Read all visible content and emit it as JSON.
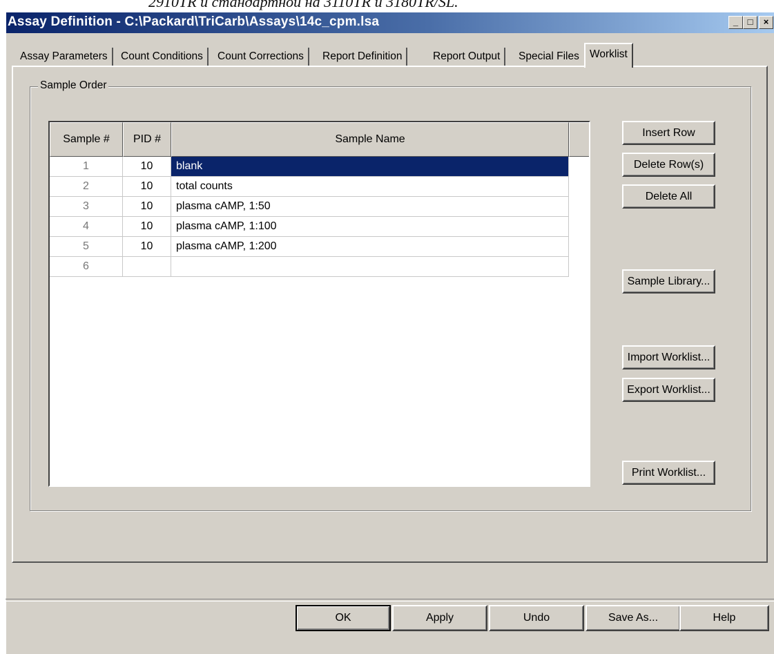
{
  "page_caption": "2910TR и стандартной на 3110TR и 3180TR/SL.",
  "window": {
    "title": "Assay Definition - C:\\Packard\\TriCarb\\Assays\\14c_cpm.lsa",
    "minimize_glyph": "_",
    "maximize_glyph": "□",
    "close_glyph": "×"
  },
  "tabs": [
    {
      "label": "Assay Parameters",
      "active": false
    },
    {
      "label": "Count Conditions",
      "active": false
    },
    {
      "label": "Count Corrections",
      "active": false
    },
    {
      "label": "Report Definition",
      "active": false
    },
    {
      "label": "Report Output",
      "active": false
    },
    {
      "label": "Special Files",
      "active": false
    },
    {
      "label": "Worklist",
      "active": true
    }
  ],
  "group": {
    "label": "Sample Order"
  },
  "grid": {
    "columns": [
      "Sample #",
      "PID #",
      "Sample Name"
    ],
    "rows": [
      {
        "num": "1",
        "pid": "10",
        "name": "blank",
        "selected": true
      },
      {
        "num": "2",
        "pid": "10",
        "name": "total counts",
        "selected": false
      },
      {
        "num": "3",
        "pid": "10",
        "name": "plasma cAMP, 1:50",
        "selected": false
      },
      {
        "num": "4",
        "pid": "10",
        "name": "plasma cAMP, 1:100",
        "selected": false
      },
      {
        "num": "5",
        "pid": "10",
        "name": "plasma cAMP, 1:200",
        "selected": false
      },
      {
        "num": "6",
        "pid": "",
        "name": "",
        "selected": false
      }
    ]
  },
  "side_buttons": {
    "insert_row": "Insert Row",
    "delete_rows": "Delete Row(s)",
    "delete_all": "Delete All",
    "sample_library": "Sample Library...",
    "import_worklist": "Import Worklist...",
    "export_worklist": "Export Worklist...",
    "print_worklist": "Print Worklist..."
  },
  "bottom_buttons": {
    "ok": "OK",
    "apply": "Apply",
    "undo": "Undo",
    "save_as": "Save As...",
    "help": "Help"
  },
  "colors": {
    "title_gradient_start": "#0a246a",
    "title_gradient_end": "#a6caf0",
    "selection": "#0a246a",
    "face": "#d4d0c8"
  }
}
